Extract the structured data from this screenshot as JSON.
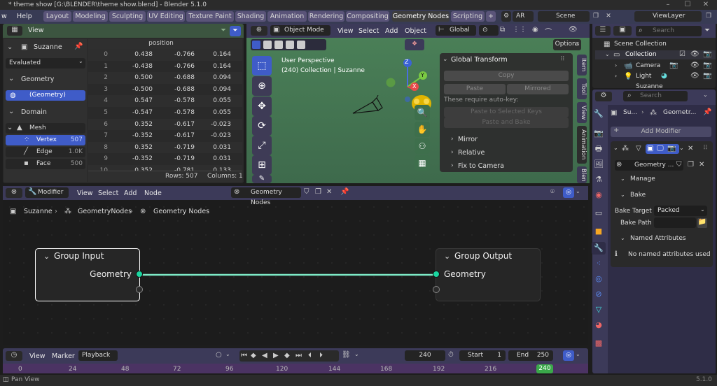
{
  "window": {
    "title": "* theme show [G:\\BLENDER\\theme show.blend] - Blender 5.1.0",
    "minimize": "–",
    "maximize": "☐",
    "close": "✕"
  },
  "topbar": {
    "menus": [
      "w",
      "Help"
    ],
    "workspaces": [
      "Layout",
      "Modeling",
      "Sculpting",
      "UV Editing",
      "Texture Paint",
      "Shading",
      "Animation",
      "Rendering",
      "Compositing",
      "Geometry Nodes",
      "Scripting"
    ],
    "active_workspace": "Geometry Nodes",
    "add": "+",
    "ar": "AR",
    "scene": "Scene",
    "view_layer": "ViewLayer"
  },
  "spreadsheet": {
    "view": "View",
    "object": "Suzanne",
    "evaluated": "Evaluated",
    "geometry_label": "Geometry",
    "geometry_item": "(Geometry)",
    "domain_label": "Domain",
    "mesh_label": "Mesh",
    "domains": [
      {
        "name": "Vertex",
        "count": "507"
      },
      {
        "name": "Edge",
        "count": "1.0K"
      },
      {
        "name": "Face",
        "count": "500"
      }
    ],
    "column_header": "position",
    "rows": [
      {
        "i": "0",
        "x": "0.438",
        "y": "-0.766",
        "z": "0.164"
      },
      {
        "i": "1",
        "x": "-0.438",
        "y": "-0.766",
        "z": "0.164"
      },
      {
        "i": "2",
        "x": "0.500",
        "y": "-0.688",
        "z": "0.094"
      },
      {
        "i": "3",
        "x": "-0.500",
        "y": "-0.688",
        "z": "0.094"
      },
      {
        "i": "4",
        "x": "0.547",
        "y": "-0.578",
        "z": "0.055"
      },
      {
        "i": "5",
        "x": "-0.547",
        "y": "-0.578",
        "z": "0.055"
      },
      {
        "i": "6",
        "x": "0.352",
        "y": "-0.617",
        "z": "-0.023"
      },
      {
        "i": "7",
        "x": "-0.352",
        "y": "-0.617",
        "z": "-0.023"
      },
      {
        "i": "8",
        "x": "0.352",
        "y": "-0.719",
        "z": "0.031"
      },
      {
        "i": "9",
        "x": "-0.352",
        "y": "-0.719",
        "z": "0.031"
      },
      {
        "i": "10",
        "x": "0.352",
        "y": "-0.781",
        "z": "0.133"
      }
    ],
    "rows_count": "Rows: 507",
    "columns_count": "Columns: 1"
  },
  "viewport": {
    "mode": "Object Mode",
    "menus": [
      "View",
      "Select",
      "Add",
      "Object"
    ],
    "orientation": "Global",
    "perspective": "User Perspective",
    "collection": "(240) Collection | Suzanne",
    "options": "Options",
    "tabs": [
      "Item",
      "Tool",
      "View",
      "Animation",
      "Blen"
    ],
    "panel": {
      "title": "Global Transform",
      "copy": "Copy",
      "paste": "Paste",
      "mirrored": "Mirrored",
      "note": "These require auto-key:",
      "paste_selected": "Paste to Selected Keys",
      "paste_bake": "Paste and Bake",
      "sections": [
        "Mirror",
        "Relative",
        "Fix to Camera"
      ]
    },
    "gizmo": {
      "x": "X",
      "y": "Y",
      "z": "Z"
    }
  },
  "node_editor": {
    "editor": "Modifier",
    "menus": [
      "View",
      "Select",
      "Add",
      "Node"
    ],
    "tree_name": "Geometry Nodes",
    "breadcrumb": [
      "Suzanne",
      "GeometryNodes",
      "Geometry Nodes"
    ],
    "nodes": {
      "input": {
        "title": "Group Input",
        "socket": "Geometry"
      },
      "output": {
        "title": "Group Output",
        "socket": "Geometry"
      }
    }
  },
  "timeline": {
    "menus": [
      "View",
      "Marker"
    ],
    "playback": "Playback",
    "current_frame": "240",
    "start_label": "Start",
    "start": "1",
    "end_label": "End",
    "end": "250",
    "ticks": [
      "0",
      "24",
      "48",
      "72",
      "96",
      "120",
      "144",
      "168",
      "192",
      "216",
      "240"
    ],
    "cursor_frame": "240"
  },
  "statusbar": {
    "hint": "Pan View",
    "version": "5.1.0"
  },
  "outliner": {
    "search_placeholder": "Search",
    "items": [
      "Scene Collection",
      "Collection",
      "Camera",
      "Light",
      "Suzanne"
    ]
  },
  "properties": {
    "search_placeholder": "Search",
    "breadcrumb_object": "Su...",
    "breadcrumb_mod": "Geometr...",
    "add_modifier": "Add Modifier",
    "tree": "Geometry ...",
    "manage": "Manage",
    "bake": "Bake",
    "bake_target_label": "Bake Target",
    "bake_target": "Packed",
    "bake_path_label": "Bake Path",
    "named_attributes": "Named Attributes",
    "no_named": "No named attributes used"
  },
  "colors": {
    "accent": "#3f5cc8",
    "header_purple": "#3c3a59",
    "spreadsheet_header": "#3c5540",
    "timeline_purple": "#4b3363",
    "socket_geometry": "#1ad6a0"
  }
}
